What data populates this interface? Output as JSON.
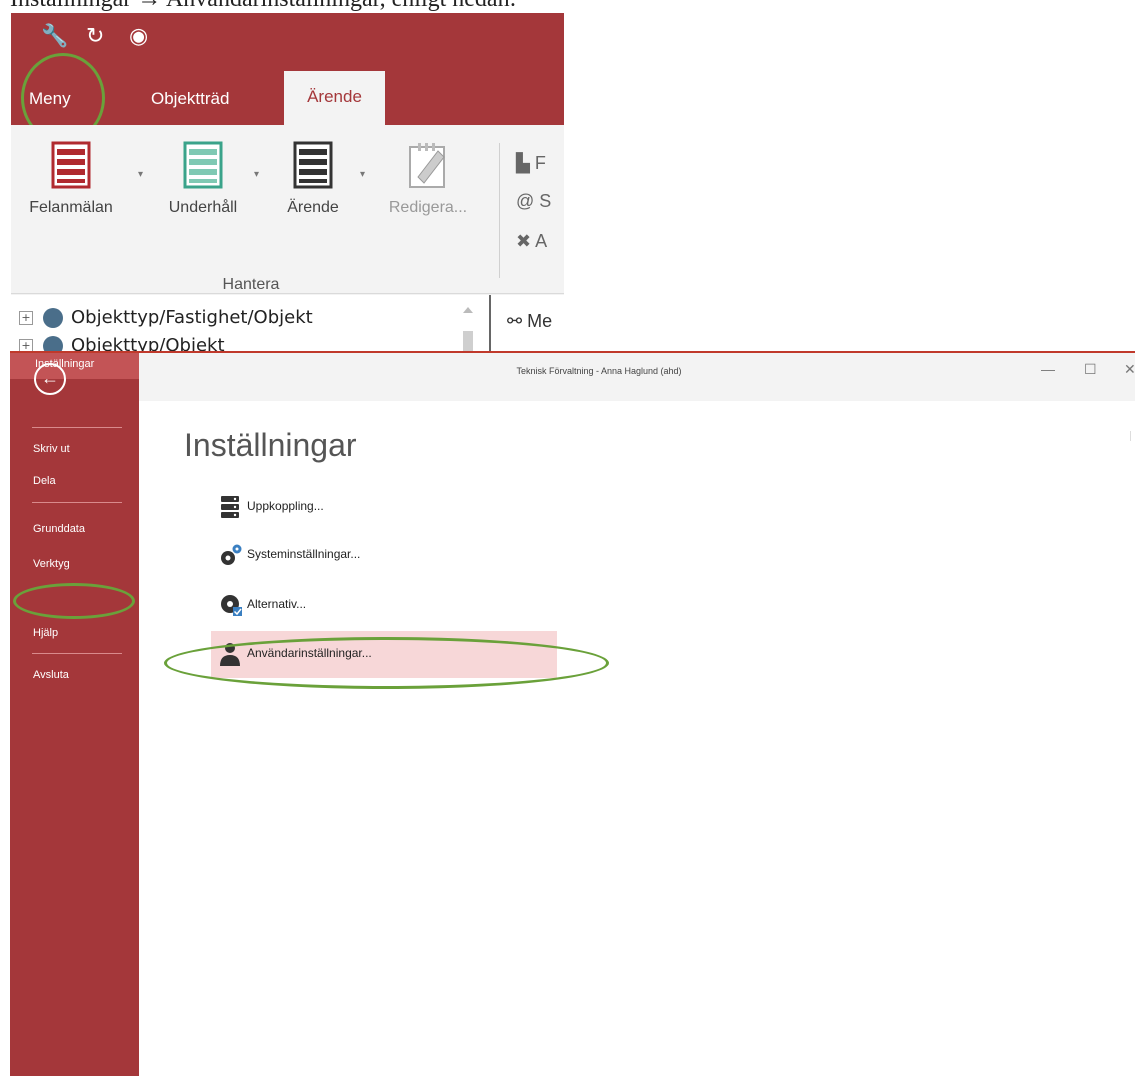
{
  "caption": "Inställningar → Användarinställningar, enligt nedan:",
  "ribbon": {
    "tabs": [
      "Meny",
      "Objektträd",
      "Ärende"
    ],
    "buttons": [
      "Felanmälan",
      "Underhåll",
      "Ärende",
      "Redigera..."
    ],
    "group_label": "Hantera",
    "side_commands": [
      "F",
      "S",
      "A"
    ],
    "tree_items": [
      "Objekttyp/Fastighet/Objekt",
      "Objekttyp/Objekt"
    ],
    "tree_right_label": "Me"
  },
  "backstage": {
    "window_title": "Teknisk Förvaltning - Anna Haglund (ahd)",
    "sidebar_items": [
      "Skriv ut",
      "Dela",
      "Grunddata",
      "Verktyg",
      "Inställningar",
      "Hjälp",
      "Avsluta"
    ],
    "page_title": "Inställningar",
    "settings_items": [
      "Uppkoppling...",
      "Systeminställningar...",
      "Alternativ...",
      "Användarinställningar..."
    ],
    "window_controls": [
      "—",
      "☐",
      "✕"
    ]
  },
  "colors": {
    "accent": "#a4373a",
    "selected_bg": "#f7d7d8",
    "highlight_ring": "#6aa13a"
  }
}
